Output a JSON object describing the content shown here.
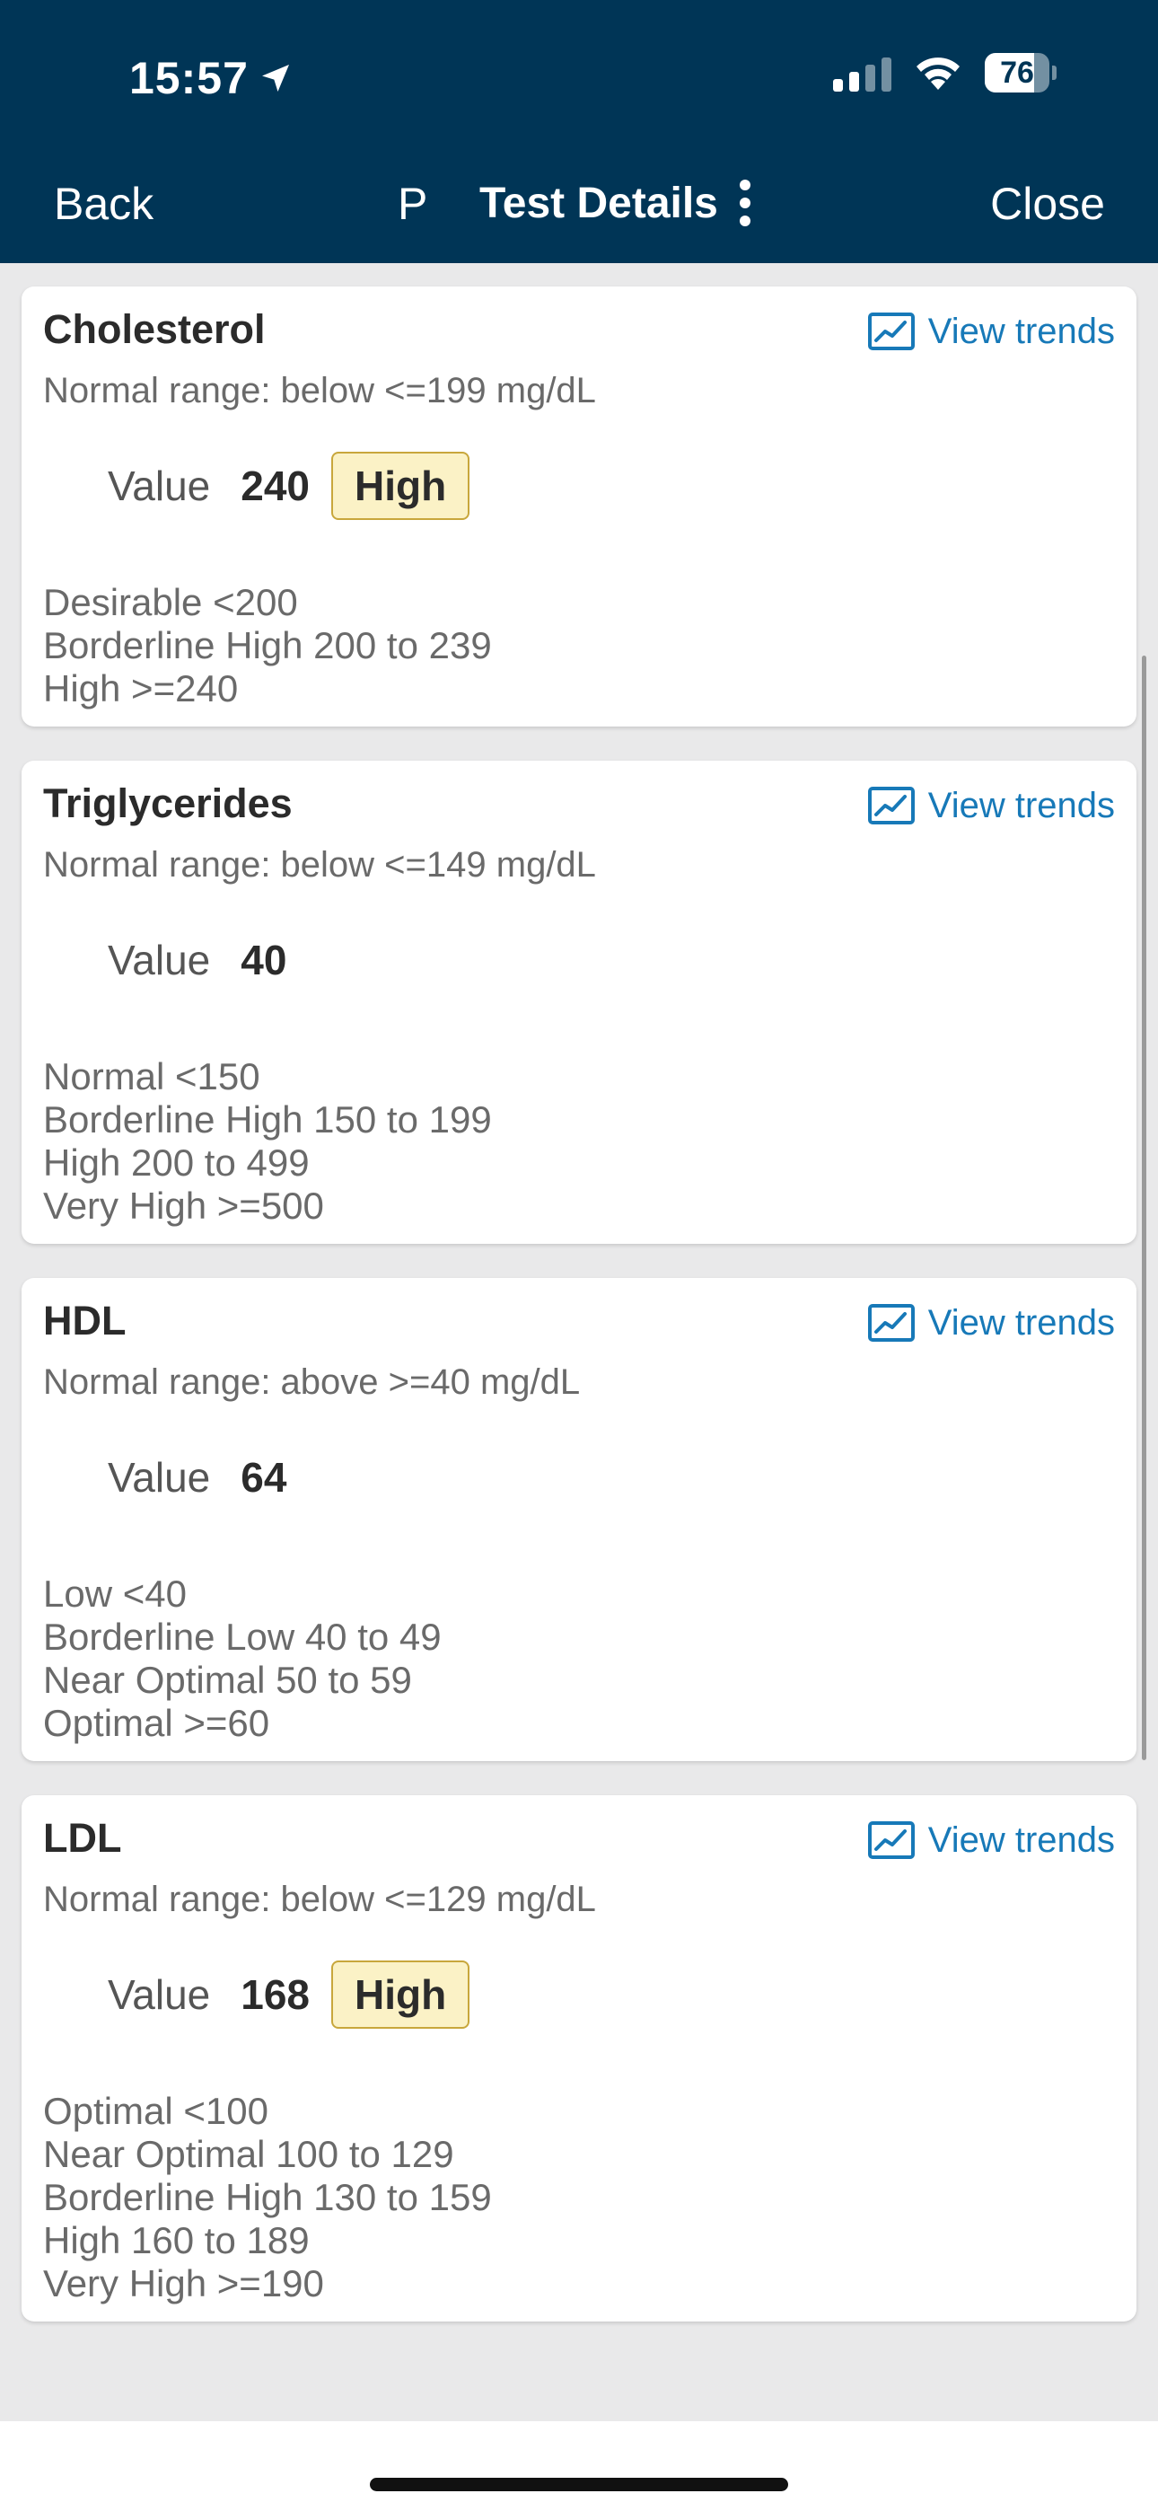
{
  "status_bar": {
    "time": "15:57",
    "battery": "76",
    "battery_level_percent": 76
  },
  "nav": {
    "back_label": "Back",
    "p_label": "P",
    "title": "Test Details",
    "close_label": "Close",
    "more_label": "⋮"
  },
  "results": [
    {
      "name": "Cholesterol",
      "view_trends_label": "View trends",
      "normal_range": "Normal range: below <=199 mg/dL",
      "value_label": "Value",
      "value": "240",
      "flag": "High",
      "ranges": [
        "Desirable <200",
        "Borderline High 200 to 239",
        "High >=240"
      ]
    },
    {
      "name": "Triglycerides",
      "view_trends_label": "View trends",
      "normal_range": "Normal range: below <=149 mg/dL",
      "value_label": "Value",
      "value": "40",
      "flag": "",
      "ranges": [
        "Normal <150",
        "Borderline High 150 to 199",
        "High 200 to 499",
        "Very High >=500"
      ]
    },
    {
      "name": "HDL",
      "view_trends_label": "View trends",
      "normal_range": "Normal range: above >=40 mg/dL",
      "value_label": "Value",
      "value": "64",
      "flag": "",
      "ranges": [
        "Low <40",
        "Borderline Low 40 to 49",
        "Near Optimal 50 to 59",
        "Optimal >=60"
      ]
    },
    {
      "name": "LDL",
      "view_trends_label": "View trends",
      "normal_range": "Normal range: below <=129 mg/dL",
      "value_label": "Value",
      "value": "168",
      "flag": "High",
      "ranges": [
        "Optimal <100",
        "Near Optimal 100 to 129",
        "Borderline High 130 to 159",
        "High 160 to 189",
        "Very High >=190"
      ]
    }
  ],
  "colors": {
    "header_bg": "#003556",
    "link": "#1779b8",
    "flag_bg": "#fbf2c6",
    "flag_border": "#c8a73c"
  }
}
